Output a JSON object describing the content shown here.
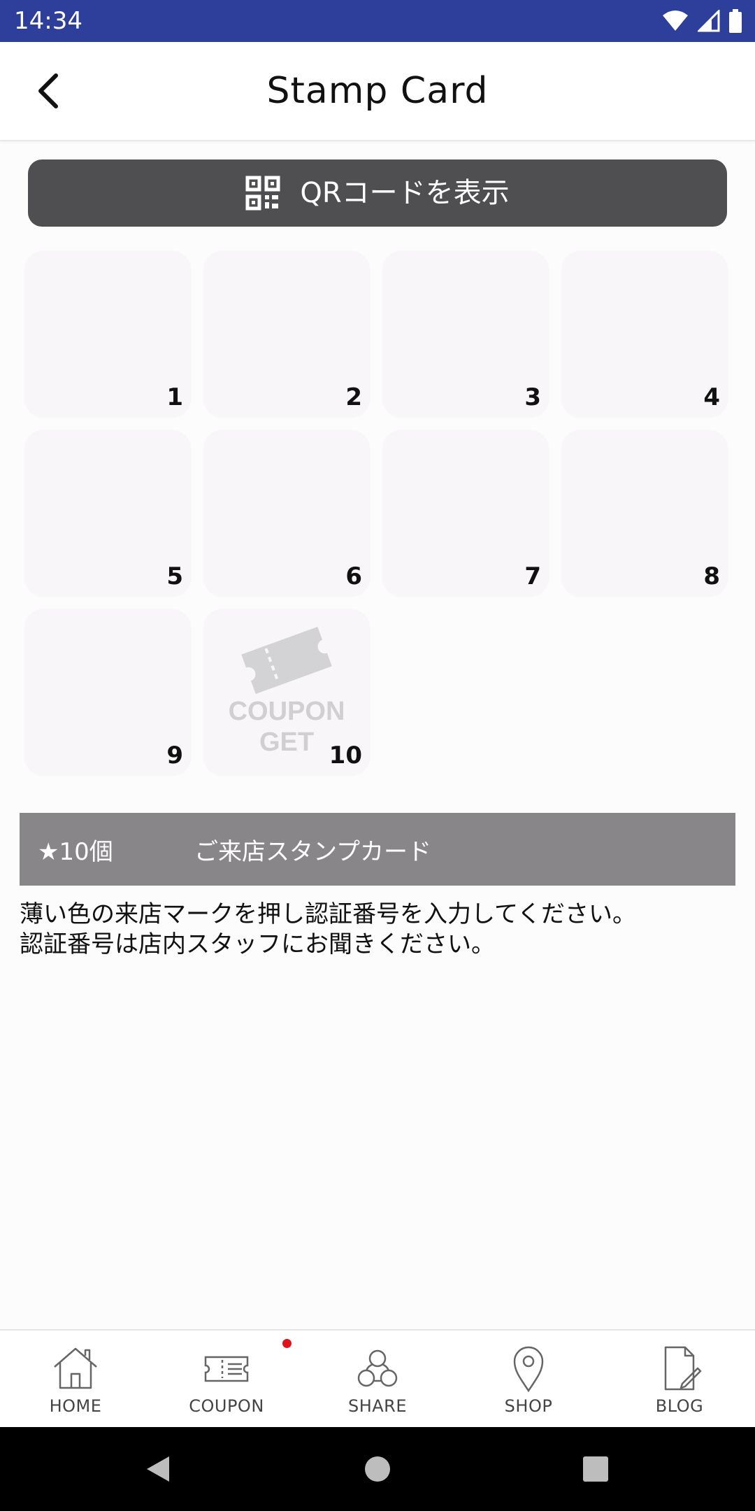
{
  "status_bar": {
    "time": "14:34",
    "icons": [
      "wifi-icon",
      "cell-signal-icon",
      "battery-icon"
    ]
  },
  "header": {
    "title": "Stamp Card",
    "back_icon": "chevron-left-icon"
  },
  "qr_button": {
    "label": "QRコードを表示",
    "icon": "qr-code-icon"
  },
  "stamps": [
    {
      "number": "1"
    },
    {
      "number": "2"
    },
    {
      "number": "3"
    },
    {
      "number": "4"
    },
    {
      "number": "5"
    },
    {
      "number": "6"
    },
    {
      "number": "7"
    },
    {
      "number": "8"
    },
    {
      "number": "9"
    },
    {
      "number": "10",
      "reward_line1": "COUPON",
      "reward_line2": "GET",
      "reward_icon": "ticket-icon"
    }
  ],
  "card_info": {
    "count": "★10個",
    "title": "ご来店スタンプカード"
  },
  "instructions": {
    "line1": "薄い色の来店マークを押し認証番号を入力してください。",
    "line2": "認証番号は店内スタッフにお聞きください。"
  },
  "bottom_nav": {
    "items": [
      {
        "label": "HOME",
        "icon": "home-icon"
      },
      {
        "label": "COUPON",
        "icon": "coupon-icon",
        "badge": true
      },
      {
        "label": "SHARE",
        "icon": "share-icon"
      },
      {
        "label": "SHOP",
        "icon": "map-pin-icon"
      },
      {
        "label": "BLOG",
        "icon": "blog-icon"
      }
    ]
  },
  "colors": {
    "status_bar": "#2e3f9b",
    "qr_button": "#4f4e51",
    "info_bar": "#888689",
    "badge": "#e0131a",
    "stamp_bg": "#f8f6f8"
  }
}
